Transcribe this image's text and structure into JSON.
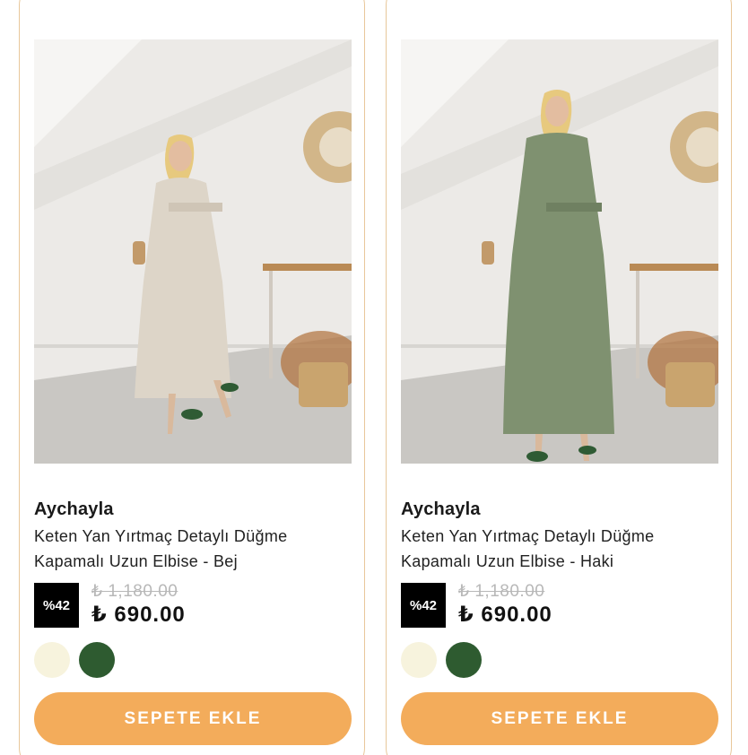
{
  "products": [
    {
      "brand": "Aychayla",
      "name": "Keten Yan Yırtmaç Detaylı Düğme Kapamalı Uzun Elbise - Bej",
      "discount": "%42",
      "old_price": "₺ 1,180.00",
      "new_price": "₺ 690.00",
      "dress_color": "#ddd5c8",
      "swatches": [
        {
          "name": "Bej",
          "color": "#f7f3dd"
        },
        {
          "name": "Haki",
          "color": "#2e5b30"
        }
      ],
      "button_label": "SEPETE EKLE"
    },
    {
      "brand": "Aychayla",
      "name": "Keten Yan Yırtmaç Detaylı Düğme Kapamalı Uzun Elbise - Haki",
      "discount": "%42",
      "old_price": "₺ 1,180.00",
      "new_price": "₺ 690.00",
      "dress_color": "#7f9170",
      "swatches": [
        {
          "name": "Bej",
          "color": "#f7f3dd"
        },
        {
          "name": "Haki",
          "color": "#2e5b30"
        }
      ],
      "button_label": "SEPETE EKLE"
    }
  ],
  "colors": {
    "accent": "#f3ac5b",
    "card_border": "#e8c79a",
    "badge_bg": "#000000"
  }
}
